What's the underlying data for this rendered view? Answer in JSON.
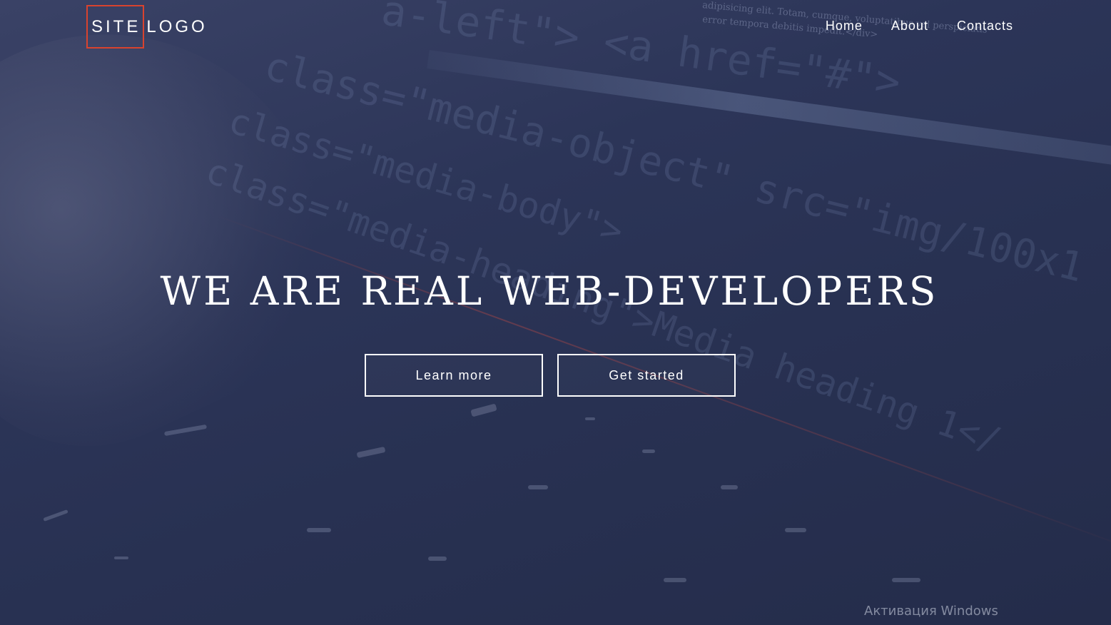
{
  "header": {
    "logo": {
      "part1": "SITE",
      "part2": "LOGO"
    },
    "nav": [
      {
        "label": "Home"
      },
      {
        "label": "About"
      },
      {
        "label": "Contacts"
      }
    ]
  },
  "hero": {
    "headline": "WE ARE REAL WEB-DEVELOPERS",
    "buttons": {
      "learn_more": "Learn more",
      "get_started": "Get started"
    }
  },
  "background_code": {
    "line1": "a-left\"> <a href=\"#\">",
    "line2": "class=\"media-object\" src=\"img/100x1",
    "line3": "class=\"media-body\">",
    "line4": "class=\"media-heading\">Media heading 1</",
    "small1": "adipisicing elit. Totam, cumque, voluptatibus vel perspiciatis",
    "small2": "error tempora debitis impedit.</div>"
  },
  "system_overlay": {
    "watermark": "Активация Windows"
  },
  "colors": {
    "accent": "#d9432e",
    "background": "#2c3558",
    "text": "#ffffff"
  }
}
